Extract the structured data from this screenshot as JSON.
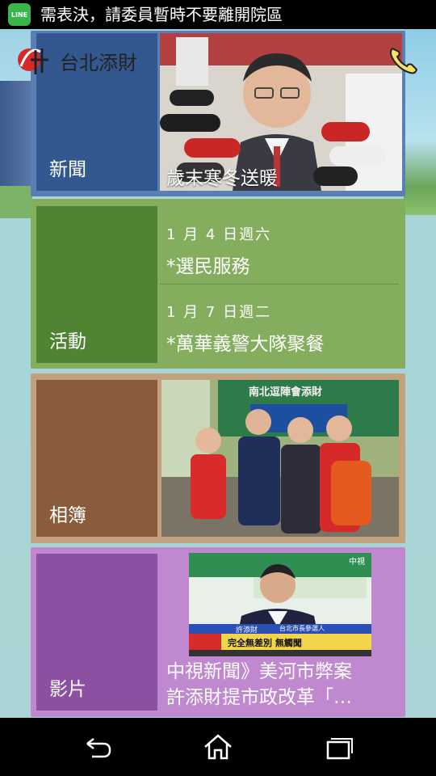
{
  "status_bar": {
    "app_icon_text": "LINE",
    "notification_text": "需表決，請委員暫時不要離開院區"
  },
  "header": {
    "title": "台北添財"
  },
  "tiles": {
    "news": {
      "label": "新聞",
      "caption": "歲末寒冬送暖",
      "colors": {
        "frame": "#5a7fb5",
        "label_bg": "#33578f"
      }
    },
    "activity": {
      "label": "活動",
      "events": [
        {
          "date": "1 月 4 日週六",
          "title": "*選民服務"
        },
        {
          "date": "1 月 7 日週二",
          "title": "*萬華義警大隊聚餐"
        }
      ],
      "colors": {
        "frame": "#85ad5e",
        "label_bg": "#4e8432"
      }
    },
    "album": {
      "label": "相簿",
      "photo_banner_text": "南北逗陣會添財",
      "colors": {
        "frame": "#c2a27e",
        "label_bg": "#8a5c3c"
      }
    },
    "video": {
      "label": "影片",
      "caption_line1": "中視新聞》美河市弊案",
      "caption_line2": "許添財提市政改革「…",
      "thumbnail_text": {
        "banner": "完全無差別 無觸聞",
        "name": "許添財",
        "subtitle": "台北市長參選人",
        "channel": "中視"
      },
      "colors": {
        "frame": "#bf88cf",
        "label_bg": "#8c4fa2"
      }
    }
  },
  "nav_bar": {
    "back_icon": "back-icon",
    "home_icon": "home-icon",
    "recents_icon": "recent-apps-icon"
  }
}
